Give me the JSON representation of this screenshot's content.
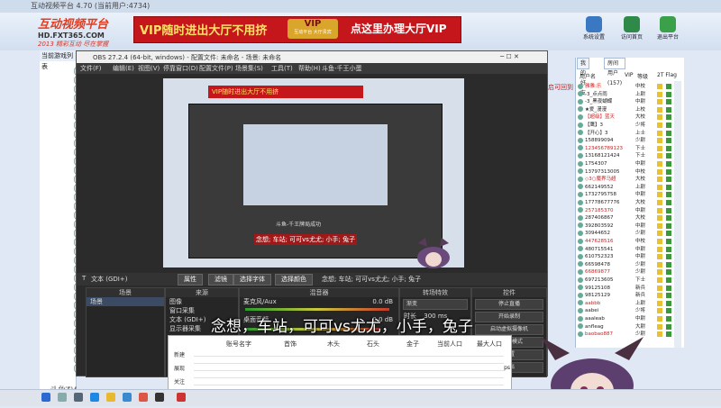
{
  "client": {
    "title": "互动视频平台 4.70 (当前用户:4734)",
    "logo": {
      "line1": "互动视频平台",
      "line2": "HD.FXT365.COM",
      "line3": "2013 精彩互动 尽在掌握"
    },
    "banner": {
      "left_text": "VIP随时进出大厅不用挤",
      "right_text": "点这里办理大厅VIP",
      "emblem_top": "VIP",
      "emblem_bottom": "互动平台 大厅贵宾"
    },
    "toolbar": [
      {
        "label": "系统设置",
        "icon": "gear-icon"
      },
      {
        "label": "访问首页",
        "icon": "home-icon"
      },
      {
        "label": "退出平台",
        "icon": "exit-icon"
      }
    ],
    "left_panel_header": "当前游戏列表",
    "room_hint": "开启可回到"
  },
  "user_panel": {
    "tabs": [
      "我的好友",
      "房间用户(157)"
    ],
    "columns": [
      "用户名",
      "VIP",
      "等级",
      "2T Flag"
    ],
    "rows": [
      {
        "name": "雅雅:乐",
        "level": "中校"
      },
      {
        "name": "-3_点点雨",
        "level": "上尉"
      },
      {
        "name": "-3_黑夜蝴蝶",
        "level": "中尉"
      },
      {
        "name": "★爱_漫漫",
        "level": "上校"
      },
      {
        "name": "【超级】蓝天",
        "level": "大校"
      },
      {
        "name": "【鹰】3",
        "level": "少将"
      },
      {
        "name": "【开心】3",
        "level": "上士"
      },
      {
        "name": "158899094",
        "level": "少尉"
      },
      {
        "name": "123456789123",
        "level": "下士"
      },
      {
        "name": "13168121424",
        "level": "下士"
      },
      {
        "name": "1754307",
        "level": "中尉"
      },
      {
        "name": "13797313005",
        "level": "中校"
      },
      {
        "name": "◇3○魔界马超",
        "level": "大校"
      },
      {
        "name": "662149552",
        "level": "上尉"
      },
      {
        "name": "1732795758",
        "level": "中尉"
      },
      {
        "name": "17778677776",
        "level": "大校"
      },
      {
        "name": "257185370",
        "level": "中尉"
      },
      {
        "name": "287406867",
        "level": "大校"
      },
      {
        "name": "392803592",
        "level": "中尉"
      },
      {
        "name": "30944652",
        "level": "少尉"
      },
      {
        "name": "447628516",
        "level": "中校"
      },
      {
        "name": "480715541",
        "level": "中尉"
      },
      {
        "name": "610752323",
        "level": "中尉"
      },
      {
        "name": "66598478",
        "level": "少尉"
      },
      {
        "name": "66869877",
        "level": "少尉"
      },
      {
        "name": "697213605",
        "level": "下士"
      },
      {
        "name": "99125108",
        "level": "新兵"
      },
      {
        "name": "98125129",
        "level": "新兵"
      },
      {
        "name": "aabbb",
        "level": "上尉"
      },
      {
        "name": "aabei",
        "level": "少将"
      },
      {
        "name": "aaaleab",
        "level": "中尉"
      },
      {
        "name": "anfleag",
        "level": "大尉"
      },
      {
        "name": "baobao887",
        "level": "少尉"
      }
    ]
  },
  "obs": {
    "title": "OBS 27.2.4 (64-bit, windows) - 配置文件: 未命名 - 场景: 未命名",
    "menu": [
      "文件(F)",
      "编辑(E)",
      "视图(V)",
      "停靠窗口(D)",
      "配置文件(P)",
      "场景集(S)",
      "工具(T)",
      "帮助(H)",
      "斗鱼-千王小蛋"
    ],
    "source_label": "文本 (GDI+)",
    "toolbar_buttons": [
      "属性",
      "滤镜",
      "选择字体",
      "选择颜色"
    ],
    "toolbar_text": "念想; 车站; 可可vs尤尤; 小手; 兔子",
    "docks": {
      "scenes": {
        "title": "场景",
        "items": [
          "场景"
        ]
      },
      "sources": {
        "title": "来源",
        "items": [
          "图像",
          "窗口采集",
          "文本 (GDI+)",
          "显示器采集"
        ]
      },
      "mixer": {
        "title": "混音器",
        "items": [
          "麦克风/Aux",
          "桌面音频"
        ],
        "levels": [
          "0.0 dB",
          "0.0 dB"
        ]
      },
      "transitions": {
        "title": "转场特效",
        "type": "渐变",
        "duration_label": "时长",
        "duration": "300 ms"
      },
      "controls": {
        "title": "控件",
        "buttons": [
          "停止直播",
          "开始录制",
          "启动虚拟摄像机",
          "工作室模式",
          "设置",
          "退出"
        ]
      }
    },
    "preview_caption": "念想; 车站; 可可vs尤尤; 小手; 兔子",
    "preview_title": "斗鱼-千王牌局成功"
  },
  "subtitle": "念想，车站，可可vs尤尤，小手，兔子",
  "sheet": {
    "columns": [
      "账号名字",
      "首饰",
      "木头",
      "石头",
      "金子",
      "当前人口",
      "最大人口"
    ],
    "side": [
      "新建",
      "展现",
      "关注"
    ],
    "footer": "fps"
  },
  "watermark": "斗鱼TV",
  "taskbar": {
    "icons": [
      "windows-icon",
      "search-icon",
      "taskview-icon",
      "edge-icon",
      "explorer-icon",
      "store-icon",
      "chrome-icon",
      "obs-icon",
      "game-icon"
    ]
  },
  "colors": {
    "accent_red": "#c5161b",
    "gold": "#ffe066",
    "obs_dark": "#2b2b2b",
    "client_blue": "#d2dff0"
  }
}
